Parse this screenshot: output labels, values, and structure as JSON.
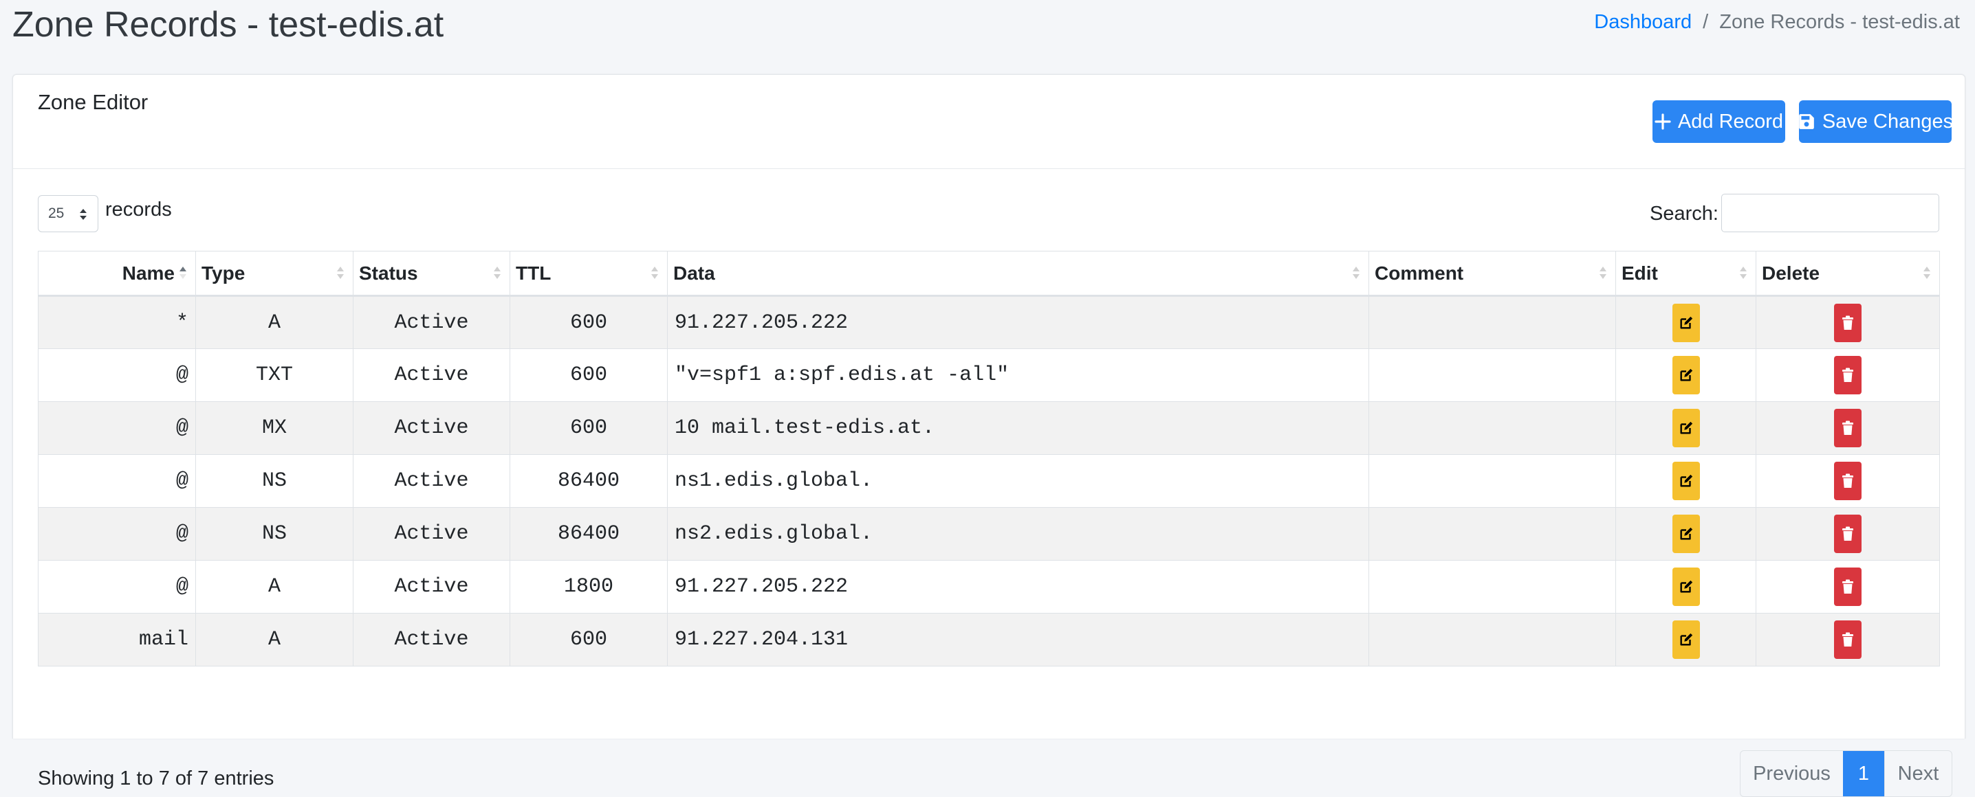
{
  "page": {
    "title": "Zone Records - test-edis.at",
    "breadcrumb": {
      "home": "Dashboard",
      "separator": "/",
      "current": "Zone Records - test-edis.at"
    }
  },
  "card": {
    "title": "Zone Editor",
    "add_label": "Add Record",
    "save_label": "Save Changes"
  },
  "controls": {
    "page_length": "25",
    "records_label": "records",
    "search_label": "Search:",
    "search_value": ""
  },
  "table": {
    "headers": [
      "Name",
      "Type",
      "Status",
      "TTL",
      "Data",
      "Comment",
      "Edit",
      "Delete"
    ],
    "sorted_column": "Name",
    "rows": [
      {
        "name": "*",
        "type": "A",
        "status": "Active",
        "ttl": "600",
        "data": "91.227.205.222",
        "comment": ""
      },
      {
        "name": "@",
        "type": "TXT",
        "status": "Active",
        "ttl": "600",
        "data": "\"v=spf1 a:spf.edis.at -all\"",
        "comment": ""
      },
      {
        "name": "@",
        "type": "MX",
        "status": "Active",
        "ttl": "600",
        "data": "10 mail.test-edis.at.",
        "comment": ""
      },
      {
        "name": "@",
        "type": "NS",
        "status": "Active",
        "ttl": "86400",
        "data": "ns1.edis.global.",
        "comment": ""
      },
      {
        "name": "@",
        "type": "NS",
        "status": "Active",
        "ttl": "86400",
        "data": "ns2.edis.global.",
        "comment": ""
      },
      {
        "name": "@",
        "type": "A",
        "status": "Active",
        "ttl": "1800",
        "data": "91.227.205.222",
        "comment": ""
      },
      {
        "name": "mail",
        "type": "A",
        "status": "Active",
        "ttl": "600",
        "data": "91.227.204.131",
        "comment": ""
      }
    ]
  },
  "footer": {
    "info": "Showing 1 to 7 of 7 entries",
    "previous": "Previous",
    "current_page": "1",
    "next": "Next"
  },
  "icons": {
    "add": "plus-icon",
    "save": "floppy-disk-icon",
    "edit": "edit-icon",
    "delete": "trash-icon"
  },
  "colors": {
    "primary": "#2b86f3",
    "edit": "#f5c02e",
    "delete": "#d9363e",
    "striped_row": "#f2f2f2"
  }
}
